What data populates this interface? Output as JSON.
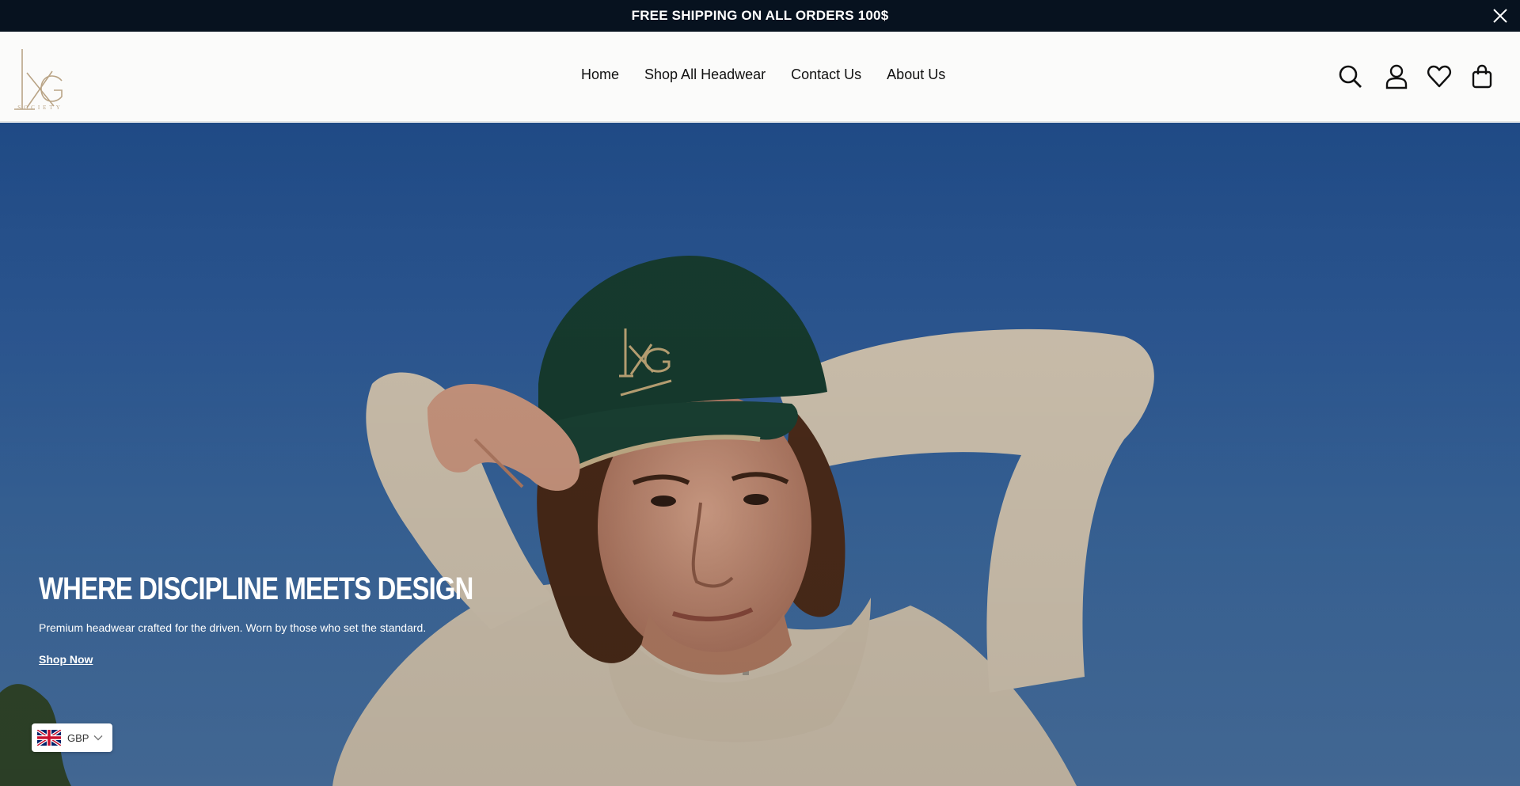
{
  "announcement": {
    "text": "FREE SHIPPING ON ALL ORDERS 100$",
    "close_icon": "close-icon"
  },
  "header": {
    "logo": {
      "monogram": "LXG",
      "wordmark": "SOCIETY"
    },
    "nav": [
      "Home",
      "Shop All Headwear",
      "Contact Us",
      "About Us"
    ],
    "icons": [
      "search-icon",
      "account-icon",
      "wishlist-heart-icon",
      "cart-bag-icon"
    ]
  },
  "hero": {
    "title": "WHERE DISCIPLINE MEETS DESIGN",
    "subtitle": "Premium headwear crafted for the driven. Worn by those who set the standard.",
    "cta": "Shop Now"
  },
  "currency": {
    "flag": "uk-flag-icon",
    "code": "GBP"
  },
  "colors": {
    "announcement_bg": "#07121f",
    "header_bg": "#fbfbfa",
    "logo_gold": "#b9a486",
    "sky_blue": "#2d5a98"
  }
}
